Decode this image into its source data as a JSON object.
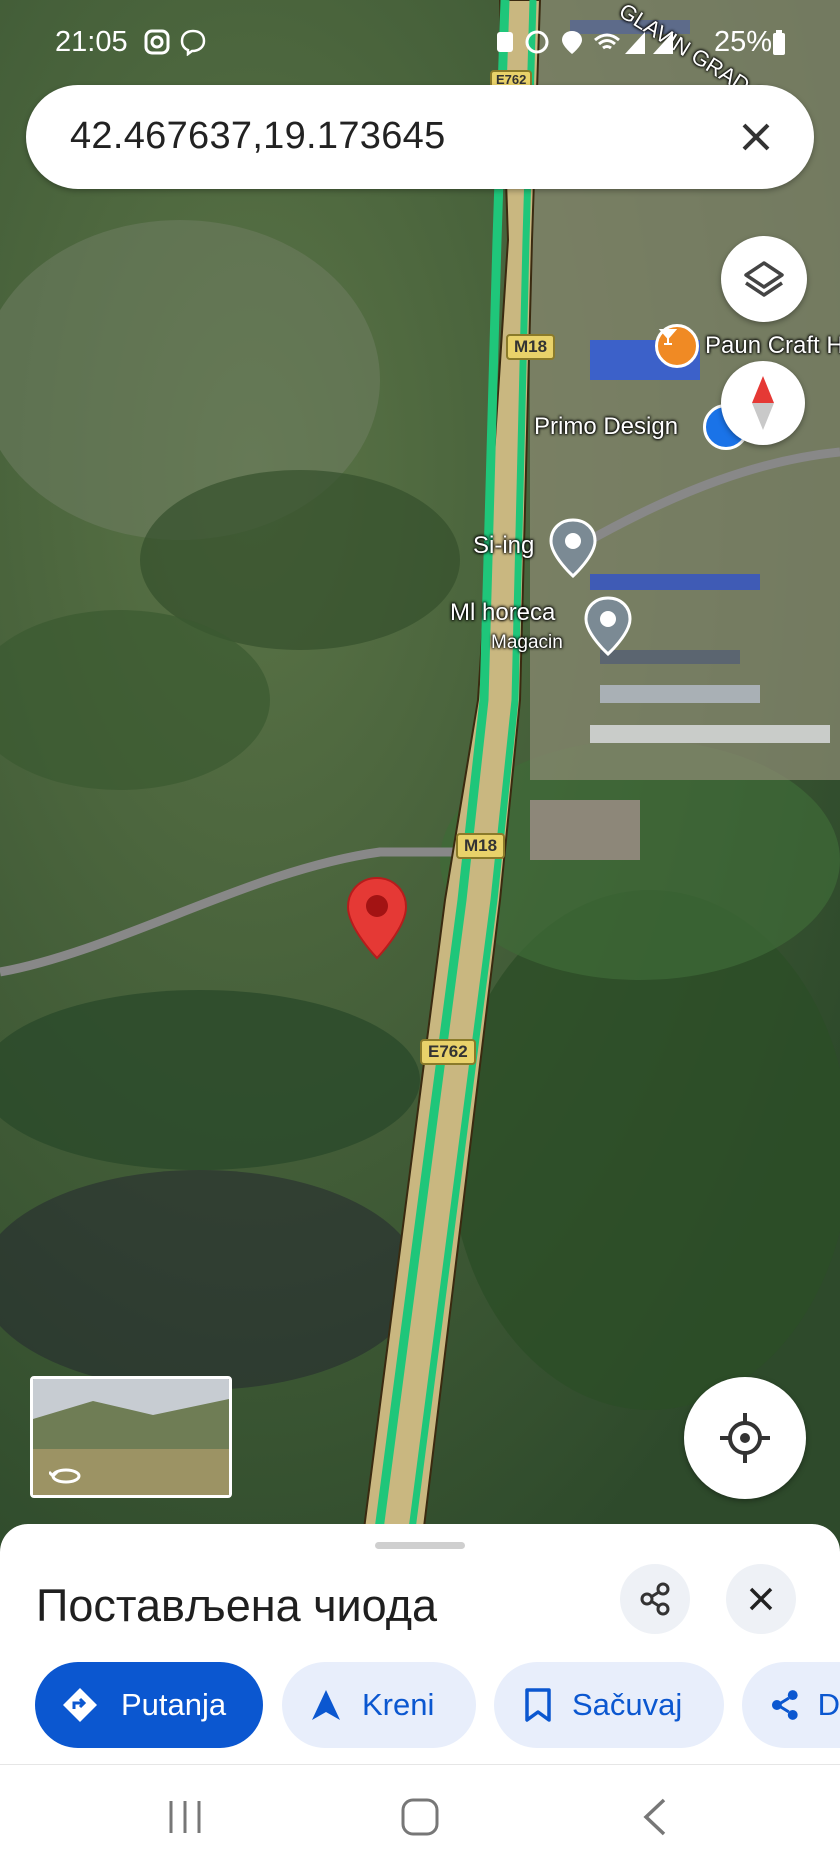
{
  "status_bar": {
    "time": "21:05",
    "battery": "25%"
  },
  "search": {
    "query": "42.467637,19.173645"
  },
  "map": {
    "poi_labels": [
      {
        "name": "paun-craft",
        "label": "Paun Craft H"
      },
      {
        "name": "primo-design",
        "label": "Primo Design"
      },
      {
        "name": "si-ing",
        "label": "Si-ing"
      },
      {
        "name": "ml-horeca",
        "label": "Ml horeca"
      }
    ],
    "poi_sublabel": "Magacin",
    "road_shields": [
      "E762",
      "M18",
      "M18",
      "E762"
    ],
    "street_label": "GLAVIN GRAD ORA",
    "accent_color": "#0b57d0",
    "pin_color": "#e53935"
  },
  "sheet": {
    "title": "Постављена чиода",
    "actions": [
      {
        "label": "Putanja",
        "icon": "directions-icon"
      },
      {
        "label": "Kreni",
        "icon": "navigate-arrow-icon"
      },
      {
        "label": "Sačuvaj",
        "icon": "bookmark-icon"
      },
      {
        "label": "D",
        "icon": "share-icon"
      }
    ]
  },
  "icons": [
    "instagram-icon",
    "viber-icon",
    "layers-icon",
    "compass-icon",
    "my-location-icon",
    "street-view-icon",
    "share-icon",
    "close-icon"
  ]
}
